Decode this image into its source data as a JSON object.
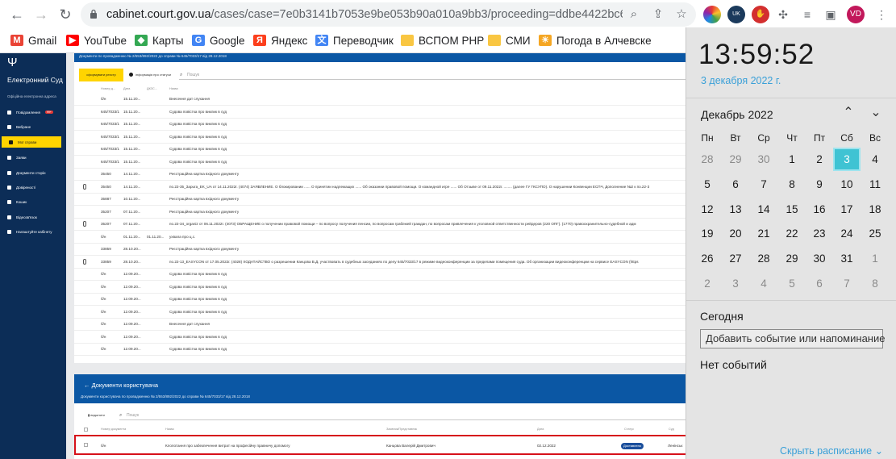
{
  "browser": {
    "url_host": "cabinet.court.gov.ua",
    "url_path": "/cases/case=7e0b3141b7053e9be053b90a010a9bb3/proceeding=ddbe4422bc68b87be...",
    "profile_initials": "VD",
    "bookmarks": [
      {
        "label": "Gmail",
        "color": "#ea4335",
        "glyph": "M"
      },
      {
        "label": "YouTube",
        "color": "#ff0000",
        "glyph": "▶"
      },
      {
        "label": "Карты",
        "color": "#34a853",
        "glyph": "◆"
      },
      {
        "label": "Google",
        "color": "#4285f4",
        "glyph": "G"
      },
      {
        "label": "Яндекс",
        "color": "#fc3f1d",
        "glyph": "Я"
      },
      {
        "label": "Переводчик",
        "color": "#4285f4",
        "glyph": "文"
      },
      {
        "label": "ВСПОМ РНР",
        "color": "#f9c642",
        "glyph": ""
      },
      {
        "label": "СМИ",
        "color": "#f9c642",
        "glyph": ""
      },
      {
        "label": "Погода в Алчевске",
        "color": "#f5a623",
        "glyph": "☀"
      }
    ]
  },
  "sidebar": {
    "title": "Електронний Суд",
    "subtitle": "Офіційна електронна адреса",
    "items": [
      {
        "label": "Повідомлення",
        "badge": "99+"
      },
      {
        "label": "Вибране"
      },
      {
        "label": "Мої справи"
      },
      {
        "label": "Заяви"
      },
      {
        "label": "Документи сторін"
      },
      {
        "label": "Довіреності"
      },
      {
        "label": "Кошик"
      },
      {
        "label": "Відеозв'язок"
      },
      {
        "label": "Налаштуйте кабінету"
      }
    ]
  },
  "documents": {
    "header": "Документи по провадженню № 2/553/892/2022 до справи № 645/7033/17 від 28.12.2018",
    "primary_button": "сформувати реєстр",
    "info_text": "інформація про статуси",
    "search_placeholder": "Пошук",
    "columns": [
      "Номер д...",
      "Дата",
      "ДКЗС...",
      "Назва"
    ],
    "rows": [
      {
        "num": "б/н",
        "date": "15.11.20...",
        "dkzs": "",
        "name": "Внесення дат слухання",
        "clip": false
      },
      {
        "num": "645/7033/1",
        "date": "15.11.20...",
        "dkzs": "",
        "name": "Судова повістка про виклик в суд",
        "clip": false
      },
      {
        "num": "645/7033/1",
        "date": "15.11.20...",
        "dkzs": "",
        "name": "Судова повістка про виклик в суд",
        "clip": false
      },
      {
        "num": "645/7033/1",
        "date": "15.11.20...",
        "dkzs": "",
        "name": "Судова повістка про виклик в суд",
        "clip": false
      },
      {
        "num": "645/7033/1",
        "date": "15.11.20...",
        "dkzs": "",
        "name": "Судова повістка про виклик в суд",
        "clip": false
      },
      {
        "num": "645/7033/1",
        "date": "15.11.20...",
        "dkzs": "",
        "name": "Судова повістка про виклик в суд",
        "clip": false
      },
      {
        "num": "35450",
        "date": "14.11.20...",
        "dkzs": "",
        "name": "Реєстраційна картка вхідного документу",
        "clip": false
      },
      {
        "num": "35450",
        "date": "14.11.20...",
        "dkzs": "",
        "name": "по.22-35_Заpura_EK_UA от 14.11.2022г. (4074) ЗАЯВЛЕНИЕ. О блокировании ...... О принятии надлежащих ...... Об оказании правовой помощи. О командной игре ...... Об Отзыве от 09.11.2022г. ........ (далее ГУ ГКСУПО). О нарушении Конвенции ЕСПЧ, Дополнение №2 к по.22-3",
        "clip": true
      },
      {
        "num": "35887",
        "date": "10.11.20...",
        "dkzs": "",
        "name": "Реєстраційна картка вхідного документу",
        "clip": false
      },
      {
        "num": "35207",
        "date": "07.11.20...",
        "dkzs": "",
        "name": "Реєстраційна картка вхідного документу",
        "clip": false
      },
      {
        "num": "35207",
        "date": "07.11.20...",
        "dkzs": "",
        "name": "по.22-34_organiz от 06.11.2022г. (4073) ОБРАЩЕНИЕ о получении правовой помощи – по вопросу получения пенсии, по вопросам грабежей граждан, по вопросам привлечения к уголовной ответственности рейдеров (220 ОПГ). (1770) правоохранительно-судебной и адм",
        "clip": true
      },
      {
        "num": "б/н",
        "date": "01.11.20...",
        "dkzs": "01.11.20...",
        "name": "ухвала про ц.с.",
        "clip": false
      },
      {
        "num": "33859",
        "date": "28.10.20...",
        "dkzs": "",
        "name": "Реєстраційна картка вхідного документу",
        "clip": false
      },
      {
        "num": "33859",
        "date": "28.10.20...",
        "dkzs": "",
        "name": "по.22-13_EASYCON от 17.05.2022г. (4028) ХОДАТАЙСТВО о разрешении Канцова В.Д. участвовать в судебных заседаниях по делу 645/7033/17 в режиме видеоконференции за пределами помещения суда. Об организации видеоконференции на сервисе EASYCON (https",
        "clip": true
      },
      {
        "num": "б/н",
        "date": "12.09.20...",
        "dkzs": "",
        "name": "Судова повістка про виклик в суд",
        "clip": false
      },
      {
        "num": "б/н",
        "date": "12.09.20...",
        "dkzs": "",
        "name": "Судова повістка про виклик в суд",
        "clip": false
      },
      {
        "num": "б/н",
        "date": "12.09.20...",
        "dkzs": "",
        "name": "Судова повістка про виклик в суд",
        "clip": false
      },
      {
        "num": "б/н",
        "date": "12.09.20...",
        "dkzs": "",
        "name": "Судова повістка про виклик в суд",
        "clip": false
      },
      {
        "num": "б/н",
        "date": "12.09.20...",
        "dkzs": "",
        "name": "Внесення дат слухання",
        "clip": false
      },
      {
        "num": "б/н",
        "date": "12.09.20...",
        "dkzs": "",
        "name": "Судова повістка про виклик в суд",
        "clip": false
      },
      {
        "num": "б/н",
        "date": "12.09.20...",
        "dkzs": "",
        "name": "Судова повістка про виклик в суд",
        "clip": false
      }
    ]
  },
  "user_documents": {
    "title": "Документи користувача",
    "subtitle": "Документи користувача по провадженню № 2/553/892/2022 до справи № 645/7033/17 від 28.12.2018",
    "delete_label": "видалити",
    "search_placeholder": "Пошук",
    "columns": [
      "Номер документа",
      "Назва",
      "Заявник/Представник",
      "Дата",
      "Статус",
      "Суд"
    ],
    "row": {
      "num": "б/н",
      "name": "Клопотання про забезпечення витрат на професійну правничу допомогу",
      "applicant": "Канцова Валерій Дмитрович",
      "date": "02.12.2022",
      "status": "Доставлено",
      "court": "Ленінськ"
    }
  },
  "calendar": {
    "time": "13:59:52",
    "full_date": "3 декабря 2022 г.",
    "month_label": "Декабрь 2022",
    "weekdays": [
      "Пн",
      "Вт",
      "Ср",
      "Чт",
      "Пт",
      "Сб",
      "Вс"
    ],
    "weeks": [
      [
        "28",
        "29",
        "30",
        "1",
        "2",
        "3",
        "4"
      ],
      [
        "5",
        "6",
        "7",
        "8",
        "9",
        "10",
        "11"
      ],
      [
        "12",
        "13",
        "14",
        "15",
        "16",
        "17",
        "18"
      ],
      [
        "19",
        "20",
        "21",
        "22",
        "23",
        "24",
        "25"
      ],
      [
        "26",
        "27",
        "28",
        "29",
        "30",
        "31",
        "1"
      ],
      [
        "2",
        "3",
        "4",
        "5",
        "6",
        "7",
        "8"
      ]
    ],
    "today_label": "Сегодня",
    "add_event_placeholder": "Добавить событие или напоминание",
    "no_events": "Нет событий",
    "hide_schedule": "Скрыть расписание"
  }
}
